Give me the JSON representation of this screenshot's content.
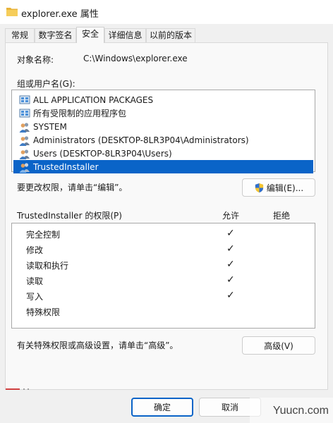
{
  "window": {
    "title": "explorer.exe 属性"
  },
  "tabs": [
    "常规",
    "数字签名",
    "安全",
    "详细信息",
    "以前的版本"
  ],
  "object": {
    "label": "对象名称:",
    "value": "C:\\Windows\\explorer.exe"
  },
  "groups": {
    "label": "组或用户名(G):",
    "items": [
      {
        "name": "ALL APPLICATION PACKAGES",
        "icon": "app-packages-icon"
      },
      {
        "name": "所有受限制的应用程序包",
        "icon": "app-packages-icon"
      },
      {
        "name": "SYSTEM",
        "icon": "users-icon"
      },
      {
        "name": "Administrators (DESKTOP-8LR3P04\\Administrators)",
        "icon": "users-icon"
      },
      {
        "name": "Users (DESKTOP-8LR3P04\\Users)",
        "icon": "users-icon"
      },
      {
        "name": "TrustedInstaller",
        "icon": "users-icon",
        "selected": true
      }
    ]
  },
  "edit": {
    "hint": "要更改权限，请单击“编辑”。",
    "button": "编辑(E)..."
  },
  "permissions": {
    "label": "TrustedInstaller 的权限(P)",
    "allow_header": "允许",
    "deny_header": "拒绝",
    "rows": [
      {
        "name": "完全控制",
        "allow": "✓"
      },
      {
        "name": "修改",
        "allow": "✓"
      },
      {
        "name": "读取和执行",
        "allow": "✓"
      },
      {
        "name": "读取",
        "allow": "✓"
      },
      {
        "name": "写入",
        "allow": "✓"
      },
      {
        "name": "特殊权限",
        "allow": ""
      }
    ]
  },
  "advanced": {
    "hint": "有关特殊权限或高级设置，请单击“高级”。",
    "button": "高级(V)"
  },
  "footer": {
    "ok": "确定",
    "cancel": "取消"
  },
  "watermark": "Yuucn.com",
  "colors": {
    "selection": "#0a64c8",
    "window": "#f0f0f0",
    "panel": "#f9f9f9"
  }
}
